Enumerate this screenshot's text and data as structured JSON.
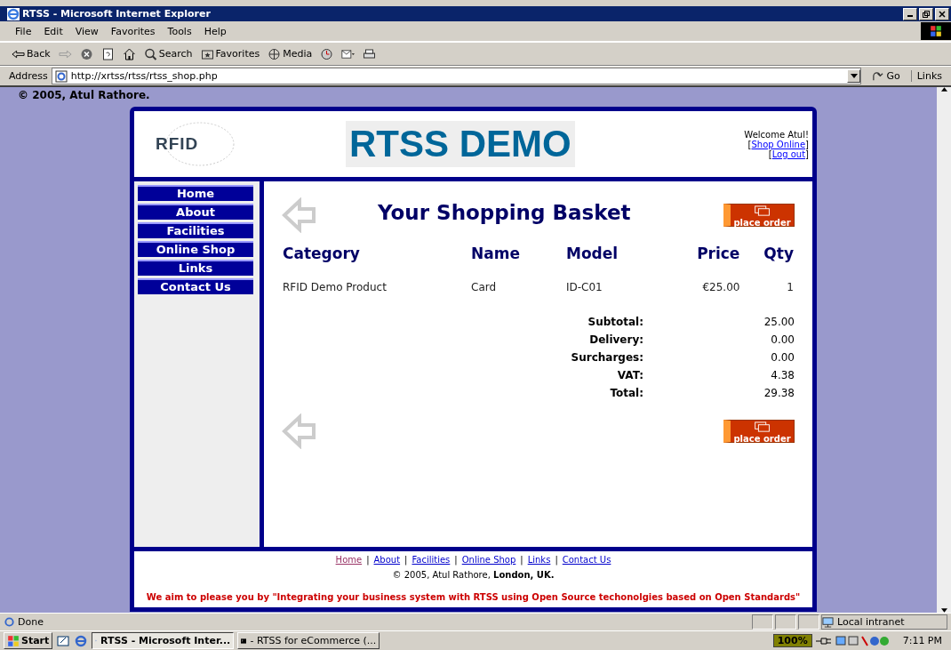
{
  "window": {
    "title": "RTSS - Microsoft Internet Explorer"
  },
  "menu": [
    "File",
    "Edit",
    "View",
    "Favorites",
    "Tools",
    "Help"
  ],
  "toolbar": [
    {
      "kind": "back",
      "label": "Back"
    },
    {
      "kind": "forward"
    },
    {
      "kind": "stop"
    },
    {
      "kind": "refresh"
    },
    {
      "kind": "home"
    },
    {
      "kind": "search",
      "label": "Search"
    },
    {
      "kind": "favorites",
      "label": "Favorites"
    },
    {
      "kind": "media",
      "label": "Media"
    },
    {
      "kind": "history"
    },
    {
      "kind": "mail"
    },
    {
      "kind": "print"
    }
  ],
  "address": {
    "label": "Address",
    "value": "http://xrtss/rtss/rtss_shop.php",
    "go": "Go",
    "links": "Links"
  },
  "page": {
    "copyright_top": "© 2005, Atul Rathore.",
    "logo_text": "RFID",
    "site_title": "RTSS DEMO",
    "welcome": "Welcome Atul!",
    "user_links": [
      {
        "open": "[",
        "label": "Shop Online",
        "close": "]"
      },
      {
        "open": "[",
        "label": "Log out",
        "close": "]"
      }
    ],
    "nav": [
      "Home",
      "About",
      "Facilities",
      "Online Shop",
      "Links",
      "Contact Us"
    ],
    "basket_title": "Your Shopping Basket",
    "place_order_top": "place order",
    "place_order_bottom": "place order",
    "columns": [
      "Category",
      "Name",
      "Model",
      "Price",
      "Qty"
    ],
    "rows": [
      [
        "RFID Demo Product",
        "Card",
        "ID-C01",
        "€25.00",
        "1"
      ]
    ],
    "totals": [
      {
        "label": "Subtotal:",
        "value": "25.00"
      },
      {
        "label": "Delivery:",
        "value": "0.00"
      },
      {
        "label": "Surcharges:",
        "value": "0.00"
      },
      {
        "label": "VAT:",
        "value": "4.38"
      },
      {
        "label": "Total:",
        "value": "29.38"
      }
    ],
    "footer_links": [
      {
        "label": "Home",
        "visited": true
      },
      {
        "separator": "|",
        "label": "About",
        "visited": false
      },
      {
        "separator": "|",
        "label": "Facilities",
        "visited": false
      },
      {
        "separator": "|",
        "label": "Online Shop",
        "visited": false
      },
      {
        "separator": "|",
        "label": "Links",
        "visited": false
      },
      {
        "separator": "|",
        "label": "Contact Us",
        "visited": false
      }
    ],
    "footer_copyright": "© 2005, Atul Rathore, **London, UK.**",
    "slogan": "We aim to please you by \"Integrating your business system with RTSS using Open Source techonolgies based on Open Standards\""
  },
  "status_bar": {
    "text": "Done",
    "zone": "Local intranet"
  },
  "taskbar": {
    "start": "Start",
    "tasks": [
      {
        "label": "RTSS - Microsoft Inter...",
        "selected": true
      },
      {
        "label": "- RTSS for eCommerce  (...",
        "selected": false
      }
    ],
    "battery": "100%",
    "clock": "7:11 PM"
  }
}
